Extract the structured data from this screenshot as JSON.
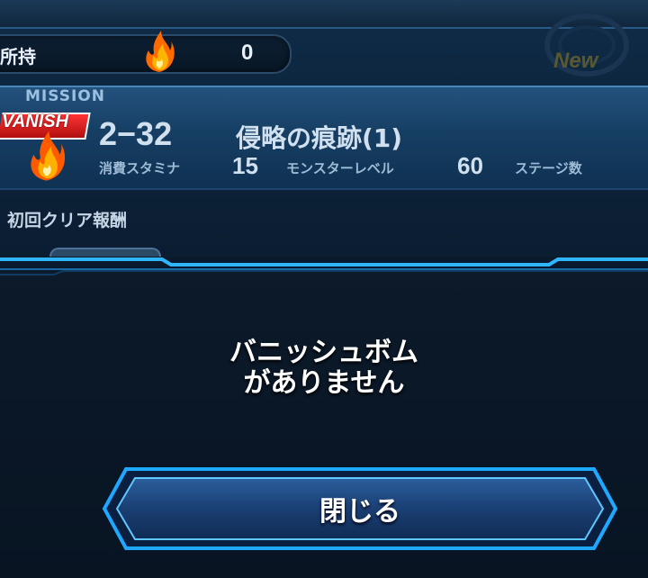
{
  "header": {
    "owned_label": "所持",
    "owned_value": "0",
    "new_badge": "New"
  },
  "mission": {
    "category": "MISSION",
    "tag": "VANISH",
    "stage_id": "2−32",
    "stage_name": "侵略の痕跡(1)",
    "stats": [
      {
        "label": "消費スタミナ",
        "value": "15"
      },
      {
        "label": "モンスターレベル",
        "value": "60"
      },
      {
        "label": "ステージ数",
        "value": ""
      }
    ],
    "first_clear_reward_label": "初回クリア報酬"
  },
  "dialog": {
    "message_line1": "バニッシュボム",
    "message_line2": "がありません",
    "close_label": "閉じる"
  },
  "colors": {
    "accent_cyan": "#2fb6ff",
    "vanish_red": "#e02020",
    "panel_blue": "#1c4a74"
  }
}
